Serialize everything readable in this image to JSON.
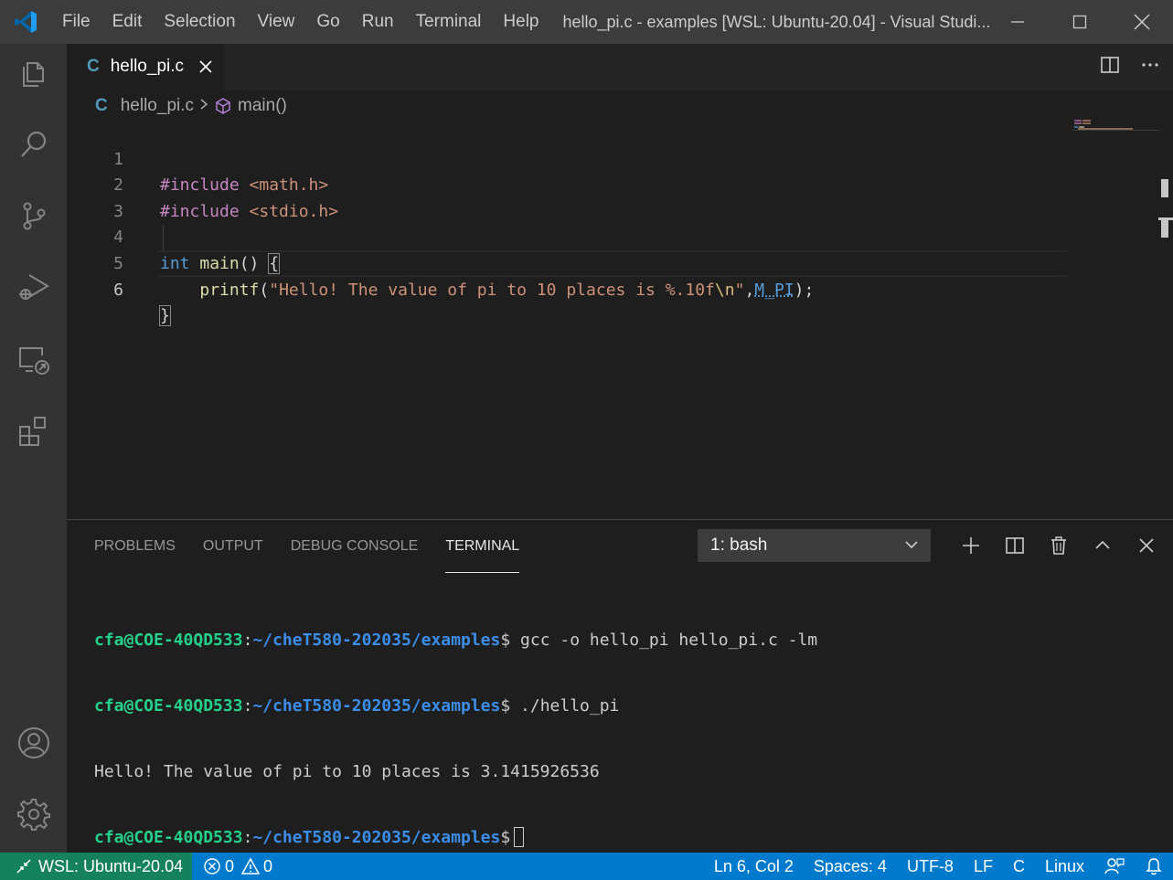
{
  "titlebar": {
    "menu": [
      "File",
      "Edit",
      "Selection",
      "View",
      "Go",
      "Run",
      "Terminal",
      "Help"
    ],
    "title": "hello_pi.c - examples [WSL: Ubuntu-20.04] - Visual Studi..."
  },
  "editor": {
    "tab_label": "hello_pi.c",
    "tab_lang_glyph": "C",
    "breadcrumb": {
      "file": "hello_pi.c",
      "symbol": "main()"
    },
    "line_numbers": [
      "1",
      "2",
      "3",
      "4",
      "5",
      "6"
    ],
    "active_line": "6",
    "code": {
      "l1_directive": "#include",
      "l1_header": " <math.h>",
      "l2_directive": "#include",
      "l2_header": " <stdio.h>",
      "l4_type": "int",
      "l4_func": " main",
      "l4_rest": "() ",
      "l4_brace": "{",
      "l5_indent": "    ",
      "l5_func": "printf",
      "l5_paren": "(",
      "l5_string": "\"Hello! The value of pi to 10 places is %.10f",
      "l5_escape": "\\n",
      "l5_string_end": "\"",
      "l5_comma": ",",
      "l5_macro": "M_PI",
      "l5_end": ");",
      "l6_brace": "}"
    }
  },
  "panel": {
    "tabs": [
      "PROBLEMS",
      "OUTPUT",
      "DEBUG CONSOLE",
      "TERMINAL"
    ],
    "active_tab": "TERMINAL",
    "terminal_select": "1: bash",
    "terminal": {
      "user": "cfa@COE-40QD533",
      "sep": ":",
      "path": "~/cheT580-202035/examples",
      "prompt": "$",
      "cmd1": " gcc -o hello_pi hello_pi.c -lm",
      "cmd2": " ./hello_pi",
      "output": "Hello! The value of pi to 10 places is 3.1415926536"
    }
  },
  "statusbar": {
    "remote": "WSL: Ubuntu-20.04",
    "errors": "0",
    "warnings": "0",
    "position": "Ln 6, Col 2",
    "spaces": "Spaces: 4",
    "encoding": "UTF-8",
    "eol": "LF",
    "language": "C",
    "platform": "Linux"
  },
  "colors": {
    "accent": "#007acc",
    "remote": "#16825d",
    "titlebar": "#3c3c3c",
    "activitybar": "#333333",
    "editor_bg": "#1e1e1e"
  },
  "icons": {
    "activity": [
      "explorer-icon",
      "search-icon",
      "source-control-icon",
      "run-debug-icon",
      "remote-explorer-icon",
      "extensions-icon",
      "account-icon",
      "settings-gear-icon"
    ]
  }
}
